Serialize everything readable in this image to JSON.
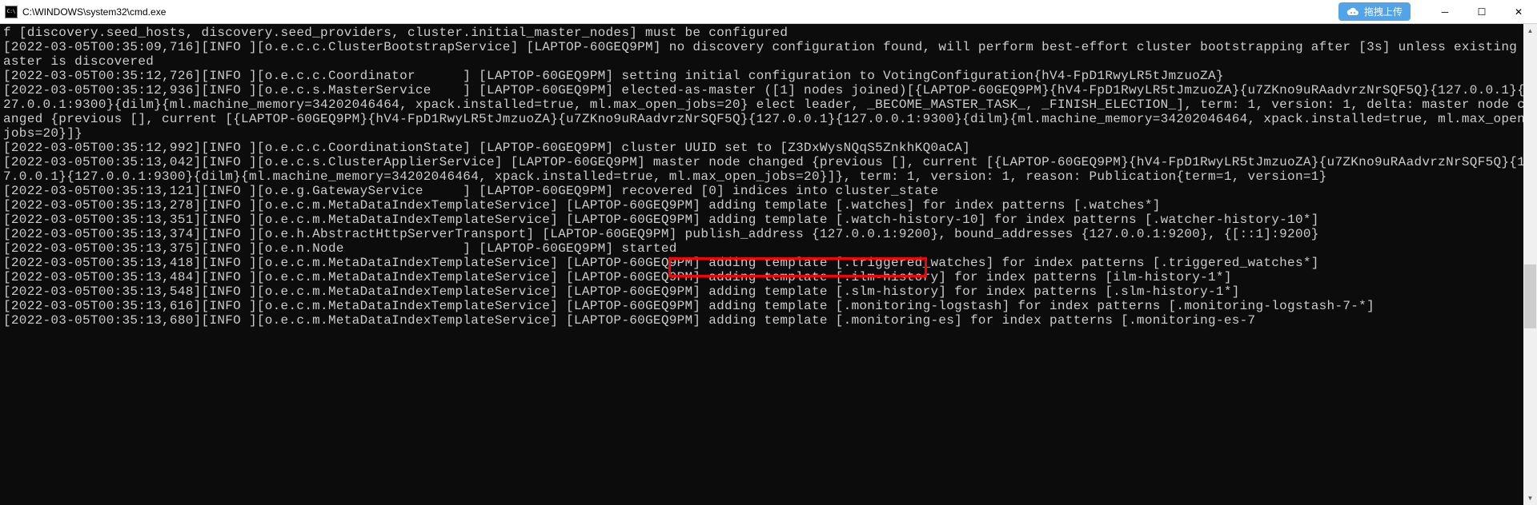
{
  "window": {
    "title": "C:\\WINDOWS\\system32\\cmd.exe"
  },
  "upload": {
    "label": "拖拽上传"
  },
  "winbtn": {
    "min": "─",
    "max": "☐",
    "close": "✕"
  },
  "scroll": {
    "up": "▲",
    "down": "▼"
  },
  "highlight": {
    "text": "publish_address {127.0.0.1:9200}",
    "top": "322",
    "left": "835",
    "width": "323",
    "height": "25"
  },
  "log": {
    "lines": [
      "f [discovery.seed_hosts, discovery.seed_providers, cluster.initial_master_nodes] must be configured",
      "[2022-03-05T00:35:09,716][INFO ][o.e.c.c.ClusterBootstrapService] [LAPTOP-60GEQ9PM] no discovery configuration found, will perform best-effort cluster bootstrapping after [3s] unless existing master is discovered",
      "[2022-03-05T00:35:12,726][INFO ][o.e.c.c.Coordinator      ] [LAPTOP-60GEQ9PM] setting initial configuration to VotingConfiguration{hV4-FpD1RwyLR5tJmzuoZA}",
      "[2022-03-05T00:35:12,936][INFO ][o.e.c.s.MasterService    ] [LAPTOP-60GEQ9PM] elected-as-master ([1] nodes joined)[{LAPTOP-60GEQ9PM}{hV4-FpD1RwyLR5tJmzuoZA}{u7ZKno9uRAadvrzNrSQF5Q}{127.0.0.1}{127.0.0.1:9300}{dilm}{ml.machine_memory=34202046464, xpack.installed=true, ml.max_open_jobs=20} elect leader, _BECOME_MASTER_TASK_, _FINISH_ELECTION_], term: 1, version: 1, delta: master node changed {previous [], current [{LAPTOP-60GEQ9PM}{hV4-FpD1RwyLR5tJmzuoZA}{u7ZKno9uRAadvrzNrSQF5Q}{127.0.0.1}{127.0.0.1:9300}{dilm}{ml.machine_memory=34202046464, xpack.installed=true, ml.max_open_jobs=20}]}",
      "[2022-03-05T00:35:12,992][INFO ][o.e.c.c.CoordinationState] [LAPTOP-60GEQ9PM] cluster UUID set to [Z3DxWysNQqS5ZnkhKQ0aCA]",
      "[2022-03-05T00:35:13,042][INFO ][o.e.c.s.ClusterApplierService] [LAPTOP-60GEQ9PM] master node changed {previous [], current [{LAPTOP-60GEQ9PM}{hV4-FpD1RwyLR5tJmzuoZA}{u7ZKno9uRAadvrzNrSQF5Q}{127.0.0.1}{127.0.0.1:9300}{dilm}{ml.machine_memory=34202046464, xpack.installed=true, ml.max_open_jobs=20}]}, term: 1, version: 1, reason: Publication{term=1, version=1}",
      "[2022-03-05T00:35:13,121][INFO ][o.e.g.GatewayService     ] [LAPTOP-60GEQ9PM] recovered [0] indices into cluster_state",
      "[2022-03-05T00:35:13,278][INFO ][o.e.c.m.MetaDataIndexTemplateService] [LAPTOP-60GEQ9PM] adding template [.watches] for index patterns [.watches*]",
      "[2022-03-05T00:35:13,351][INFO ][o.e.c.m.MetaDataIndexTemplateService] [LAPTOP-60GEQ9PM] adding template [.watch-history-10] for index patterns [.watcher-history-10*]",
      "[2022-03-05T00:35:13,374][INFO ][o.e.h.AbstractHttpServerTransport] [LAPTOP-60GEQ9PM] publish_address {127.0.0.1:9200}, bound_addresses {127.0.0.1:9200}, {[::1]:9200}",
      "[2022-03-05T00:35:13,375][INFO ][o.e.n.Node               ] [LAPTOP-60GEQ9PM] started",
      "[2022-03-05T00:35:13,418][INFO ][o.e.c.m.MetaDataIndexTemplateService] [LAPTOP-60GEQ9PM] adding template [.triggered_watches] for index patterns [.triggered_watches*]",
      "[2022-03-05T00:35:13,484][INFO ][o.e.c.m.MetaDataIndexTemplateService] [LAPTOP-60GEQ9PM] adding template [.ilm-history] for index patterns [ilm-history-1*]",
      "[2022-03-05T00:35:13,548][INFO ][o.e.c.m.MetaDataIndexTemplateService] [LAPTOP-60GEQ9PM] adding template [.slm-history] for index patterns [.slm-history-1*]",
      "[2022-03-05T00:35:13,616][INFO ][o.e.c.m.MetaDataIndexTemplateService] [LAPTOP-60GEQ9PM] adding template [.monitoring-logstash] for index patterns [.monitoring-logstash-7-*]",
      "[2022-03-05T00:35:13,680][INFO ][o.e.c.m.MetaDataIndexTemplateService] [LAPTOP-60GEQ9PM] adding template [.monitoring-es] for index patterns [.monitoring-es-7"
    ]
  }
}
